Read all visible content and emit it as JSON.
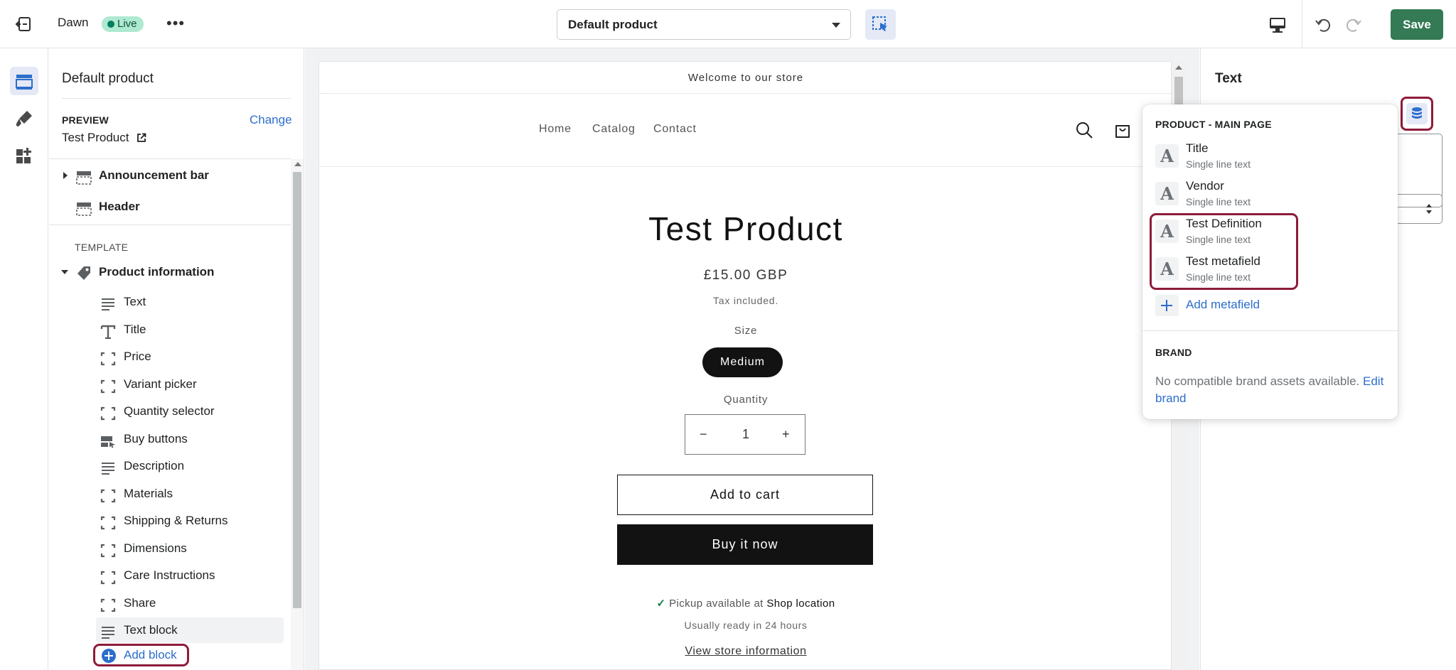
{
  "topbar": {
    "theme_name": "Dawn",
    "live_badge": "Live",
    "more_label": "•••",
    "template_select": "Default product",
    "save_label": "Save"
  },
  "sidebar": {
    "title": "Default product",
    "preview_label": "PREVIEW",
    "preview_change": "Change",
    "preview_product": "Test Product",
    "sections_top": [
      {
        "label": "Announcement bar"
      },
      {
        "label": "Header"
      }
    ],
    "template_label": "TEMPLATE",
    "product_section": "Product information",
    "blocks": [
      {
        "label": "Text"
      },
      {
        "label": "Title"
      },
      {
        "label": "Price"
      },
      {
        "label": "Variant picker"
      },
      {
        "label": "Quantity selector"
      },
      {
        "label": "Buy buttons"
      },
      {
        "label": "Description"
      },
      {
        "label": "Materials"
      },
      {
        "label": "Shipping & Returns"
      },
      {
        "label": "Dimensions"
      },
      {
        "label": "Care Instructions"
      },
      {
        "label": "Share"
      },
      {
        "label": "Text block"
      }
    ],
    "add_block": "Add block"
  },
  "preview": {
    "announcement": "Welcome to our store",
    "nav": [
      "Home",
      "Catalog",
      "Contact"
    ],
    "product_title": "Test Product",
    "price": "£15.00 GBP",
    "tax": "Tax included.",
    "size_label": "Size",
    "size_value": "Medium",
    "quantity_label": "Quantity",
    "quantity_minus": "−",
    "quantity_value": "1",
    "quantity_plus": "+",
    "add_to_cart": "Add to cart",
    "buy_now": "Buy it now",
    "pickup_check": "✓",
    "pickup_text": "Pickup available at",
    "pickup_location": "Shop location",
    "ready_text": "Usually ready in 24 hours",
    "view_store": "View store information"
  },
  "settings": {
    "title": "Text"
  },
  "popover": {
    "heading": "PRODUCT - MAIN PAGE",
    "glyph": "A",
    "items": [
      {
        "name": "Title",
        "type": "Single line text"
      },
      {
        "name": "Vendor",
        "type": "Single line text"
      },
      {
        "name": "Test Definition",
        "type": "Single line text"
      },
      {
        "name": "Test metafield",
        "type": "Single line text"
      }
    ],
    "add_metafield": "Add metafield",
    "brand_heading": "BRAND",
    "brand_text": "No compatible brand assets available.",
    "brand_link": "Edit brand"
  },
  "colors": {
    "accent": "#2c6ecb",
    "save_green": "#337a55",
    "highlight": "#8e1b3a",
    "live_badge_bg": "#aee9d1"
  }
}
